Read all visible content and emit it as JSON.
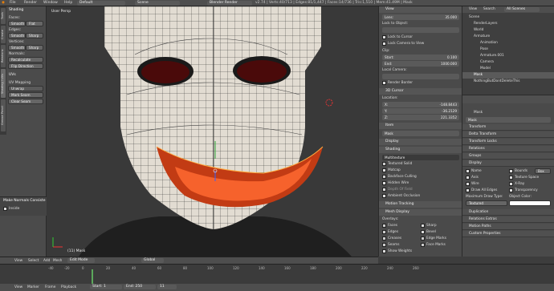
{
  "topbar": {
    "menus": [
      "File",
      "Render",
      "Window",
      "Help"
    ],
    "layout": "Default",
    "scene": "Scene",
    "engine": "Blender Render",
    "stats": "v2.74 | Verts:40/713 | Edges:81/1,447 | Faces:14/736 | Tris:1,510 | Mem:41.49M | Mask"
  },
  "left_tabs": [
    "Tools",
    "Create",
    "Relations",
    "Shading / UVs",
    "Grease Pencil"
  ],
  "tools": {
    "shading_title": "Shading",
    "faces_label": "Faces:",
    "edges_label": "Edges:",
    "vertices_label": "Vertices:",
    "normals_label": "Normals:",
    "smooth": "Smooth",
    "flat": "Flat",
    "sharp": "Sharp",
    "recalculate": "Recalculate",
    "flip_direction": "Flip Direction",
    "uvs_title": "UVs",
    "uv_mapping": "UV Mapping",
    "unwrap": "Unwrap",
    "mark_seam": "Mark Seam",
    "clear_seam": "Clear Seam",
    "operator_title": "Make Normals Consiste",
    "inside": "Inside"
  },
  "viewport": {
    "label": "User Persp",
    "object_label": "(11) Mask"
  },
  "npanel": {
    "view_title": "View",
    "lens_label": "Lens:",
    "lens_value": "35.000",
    "lock_to_object": "Lock to Object:",
    "lock_to_cursor": "Lock to Cursor",
    "lock_camera": "Lock Camera to View",
    "clip_title": "Clip:",
    "start_label": "Start:",
    "start_value": "0.100",
    "end_label": "End:",
    "end_value": "1000.000",
    "local_camera": "Local Camera:",
    "render_border": "Render Border",
    "cursor_title": "3D Cursor",
    "location_label": "Location:",
    "x_label": "X:",
    "x_value": "-148.8443",
    "y_label": "Y:",
    "y_value": "-36.2129",
    "z_label": "Z:",
    "z_value": "221.3352",
    "item_title": "Item",
    "item_name": "Mask",
    "display_title": "Display",
    "shading_title": "Shading",
    "shading_mode": "Multitexture",
    "textured_solid": "Textured Solid",
    "matcap": "Matcap",
    "backface": "Backface Culling",
    "hidden_wire": "Hidden Wire",
    "depth_of_field": "Depth Of Field",
    "ambient_occlusion": "Ambient Occlusion",
    "motion_tracking": "Motion Tracking",
    "mesh_display": "Mesh Display",
    "overlays": "Overlays:",
    "faces": "Faces",
    "sharp": "Sharp",
    "edges": "Edges",
    "bevel": "Bevel",
    "creases": "Creases",
    "edge_marks": "Edge Marks",
    "seams": "Seams",
    "face_marks": "Face Marks",
    "show_weights": "Show Weights"
  },
  "outliner": {
    "view": "View",
    "search": "Search",
    "filter": "All Scenes",
    "items": [
      "Scene",
      "RenderLayers",
      "World",
      "Armature",
      "Animation",
      "Pose",
      "Armature.001",
      "Camera",
      "Model",
      "Mask",
      "NothingButDontDeleteThis"
    ]
  },
  "properties": {
    "object_name": "Mask",
    "field_name": "Mask",
    "sections": [
      "Transform",
      "Delta Transform",
      "Transform Locks",
      "Relations",
      "Groups",
      "Display"
    ],
    "display": {
      "name": "Name",
      "bounds": "Bounds",
      "bounds_type": "Box",
      "axis": "Axis",
      "texture_space": "Texture Space",
      "wire": "Wire",
      "xray": "X-Ray",
      "draw_all_edges": "Draw All Edges",
      "transparency": "Transparency",
      "max_draw_type": "Maximum Draw Type:",
      "object_color": "Object Color:",
      "draw_type_value": "Textured"
    },
    "more_sections": [
      "Duplication",
      "Relations Extras",
      "Motion Paths",
      "Custom Properties"
    ]
  },
  "bottombar": {
    "view": "View",
    "select": "Select",
    "add": "Add",
    "mesh": "Mesh",
    "mode": "Edit Mode",
    "orientation": "Global"
  },
  "timeline": {
    "labels": [
      "View",
      "Marker",
      "Frame",
      "Playback"
    ],
    "start_label": "Start:",
    "start_value": "1",
    "end_label": "End:",
    "end_value": "250",
    "current": "11",
    "ticks": [
      "-40",
      "-20",
      "0",
      "20",
      "40",
      "60",
      "80",
      "100",
      "120",
      "140",
      "160",
      "180",
      "200",
      "220",
      "240",
      "260"
    ]
  },
  "colors": {
    "mouth_outer": "#c23b14",
    "mouth_inner": "#ff6a30",
    "eye": "#4a0a0a",
    "mask": "#e3ddd4",
    "selection": "#ffaa40"
  }
}
